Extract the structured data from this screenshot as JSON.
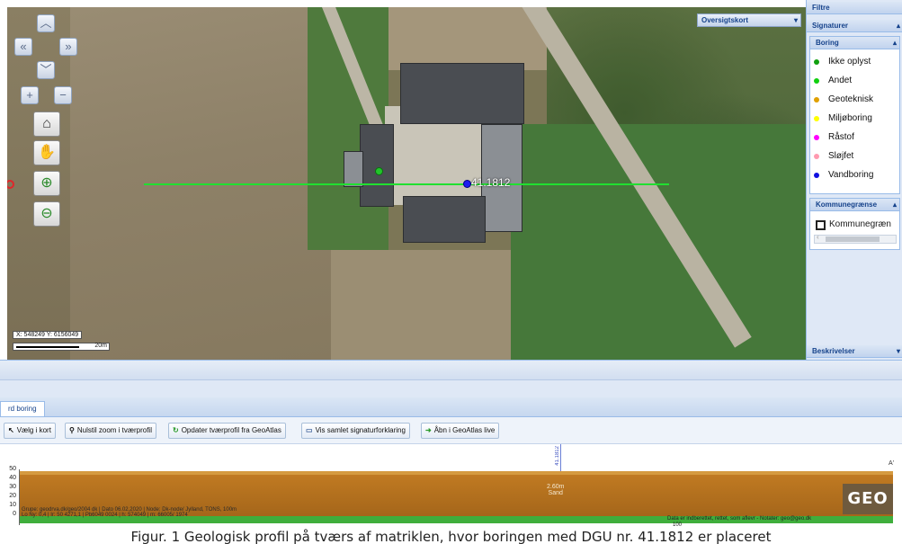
{
  "map": {
    "overview_label": "Oversigtskort",
    "bore_label": "41.1812",
    "scale_text": "X: 548249 Y: 6156049",
    "scale_unit": "20m"
  },
  "nav": {
    "up": "︿",
    "left": "«",
    "right": "»",
    "down": "﹀",
    "zoom_in_small": "+",
    "zoom_out_small": "−"
  },
  "panel": {
    "filtre": "Filtre",
    "signaturer": "Signaturer",
    "boring": "Boring",
    "legend": [
      {
        "label": "Ikke oplyst",
        "color": "#10a010"
      },
      {
        "label": "Andet",
        "color": "#10d010"
      },
      {
        "label": "Geoteknisk",
        "color": "#e0a000"
      },
      {
        "label": "Miljøboring",
        "color": "#ffff00"
      },
      {
        "label": "Råstof",
        "color": "#ff00ff"
      },
      {
        "label": "Sløjfet",
        "color": "#ff9ab0"
      },
      {
        "label": "Vandboring",
        "color": "#1010e0"
      }
    ],
    "kommunegraense_head": "Kommunegrænse",
    "kommunegraense_item": "Kommunegræn",
    "beskrivelser": "Beskrivelser"
  },
  "lower": {
    "tab_label": "rd boring",
    "toolbar": [
      {
        "icon": "↖",
        "label": "Vælg i kort"
      },
      {
        "icon": "⚲",
        "label": "Nulstil zoom i tværprofil"
      },
      {
        "icon": "↻",
        "label": "Opdater tværprofil fra GeoAtlas"
      },
      {
        "icon": "▭",
        "label": "Vis samlet signaturforklaring"
      },
      {
        "icon": "➜",
        "label": "Åbn i GeoAtlas live"
      }
    ]
  },
  "profile": {
    "y_ticks": [
      "50",
      "40",
      "30",
      "20",
      "10",
      "0"
    ],
    "bore_vertical_label": "41.1812",
    "layer_text": "2.60m",
    "layer_subtext": "Sand",
    "logo": "GEO",
    "credit_line1": "Grupe: geodrva.dk/geo/2004 dk | Dato 06.02.2020 | Node: Dk-node/ Jylland, TONS, 100m",
    "credit_line2": "Lo Ny: 0,4 | Ir: 50 4271,1 | Pb6049 0024 | h: 574049 | m: 66005/ 1974",
    "credit_right": "Data er indberettet, rettet, som aflevr - Notater: geo@geo.dk",
    "distance_label": "100",
    "end_label": "A'"
  },
  "caption": "Figur. 1 Geologisk profil på tværs af matriklen, hvor boringen med DGU nr. 41.1812 er placeret"
}
